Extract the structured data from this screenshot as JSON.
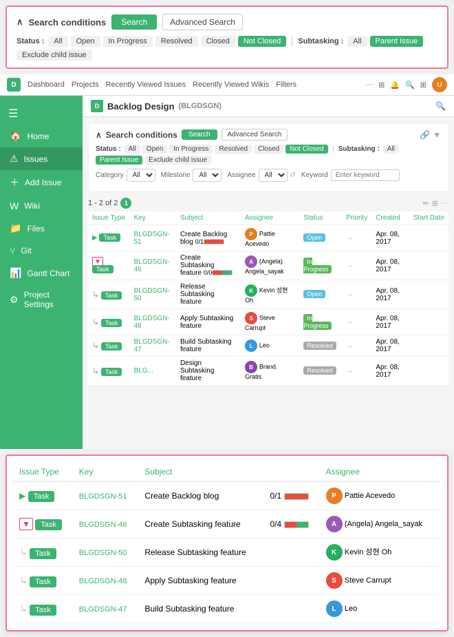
{
  "topSearch": {
    "title": "Search conditions",
    "searchBtn": "Search",
    "advancedBtn": "Advanced Search",
    "statusLabel": "Status :",
    "statuses": [
      "All",
      "Open",
      "In Progress",
      "Resolved",
      "Closed",
      "Not Closed"
    ],
    "activeStatus": "Not Closed",
    "subtaskingLabel": "Subtasking :",
    "subtaskings": [
      "All",
      "Parent Issue",
      "Exclude child issue"
    ],
    "activeSubtasking": "Parent Issue"
  },
  "nav": {
    "logo": "D",
    "links": [
      "Dashboard",
      "Projects",
      "Recently Viewed Issues",
      "Recently Viewed Wikis",
      "Filters"
    ]
  },
  "sidebar": {
    "hamburger": "☰",
    "items": [
      {
        "icon": "🏠",
        "label": "Home"
      },
      {
        "icon": "⚠",
        "label": "Issues"
      },
      {
        "icon": "+",
        "label": "Add Issue"
      },
      {
        "icon": "W",
        "label": "Wiki"
      },
      {
        "icon": "📁",
        "label": "Files"
      },
      {
        "icon": "⑂",
        "label": "Git"
      },
      {
        "icon": "📊",
        "label": "Gantt Chart"
      },
      {
        "icon": "⚙",
        "label": "Project Settings"
      }
    ]
  },
  "content": {
    "projectName": "Backlog Design",
    "projectId": "(BLGDSGN)",
    "searchTitle": "Search conditions",
    "searchBtn": "Search",
    "advancedBtn": "Advanced Search",
    "statusLabel": "Status :",
    "statuses": [
      "All",
      "Open",
      "In Progress",
      "Resolved",
      "Closed",
      "Not Closed"
    ],
    "activeStatus": "Not Closed",
    "subtaskingLabel": "Subtasking :",
    "subtaskings": [
      "All",
      "Parent Issue",
      "Exclude child issue"
    ],
    "activeSubtasking": "Parent Issue",
    "categoryLabel": "Category",
    "milestoneLabel": "Milestone",
    "assigneeLabel": "Assignee",
    "keywordLabel": "Keyword",
    "keywordPlaceholder": "Enter keyword",
    "resultText": "1 - 2 of 2",
    "resultCount": "1",
    "tableHeaders": [
      "Issue Type",
      "Key",
      "Subject",
      "Assignee",
      "Status",
      "Priority",
      "Created",
      "Start Date"
    ],
    "rows": [
      {
        "expand": "▶",
        "type": "Task",
        "key": "BLGDSGN-51",
        "subject": "Create Backlog blog",
        "progress": "0/1",
        "progressType": "red",
        "assigneeColor": "#e67e22",
        "assigneeInitial": "P",
        "assignee": "Pattie Acevedo",
        "status": "Open",
        "statusType": "open",
        "date": "Apr. 08, 2017"
      },
      {
        "expand": "▼",
        "type": "Task",
        "key": "BLGDSGN-46",
        "subject": "Create Subtasking feature",
        "progress": "0/0",
        "progressType": "multi",
        "assigneeColor": "#9b59b6",
        "assigneeInitial": "A",
        "assignee": "(Angela) Angela_sayak",
        "status": "In Progress",
        "statusType": "inprogress",
        "date": "Apr. 08, 2017"
      },
      {
        "expand": "↳",
        "type": "Task",
        "key": "BLGDSGN-50",
        "subject": "Release Subtasking feature",
        "progress": "",
        "progressType": "",
        "assigneeColor": "#27ae60",
        "assigneeInitial": "K",
        "assignee": "Kevin 성현 Oh",
        "status": "Open",
        "statusType": "open",
        "date": "Apr. 08, 2017"
      },
      {
        "expand": "↳",
        "type": "Task",
        "key": "BLGDSGN-48",
        "subject": "Apply Subtasking feature",
        "progress": "",
        "progressType": "",
        "assigneeColor": "#e74c3c",
        "assigneeInitial": "S",
        "assignee": "Steve Carrupt",
        "status": "In Progress",
        "statusType": "inprogress",
        "date": "Apr. 08, 2017"
      },
      {
        "expand": "↳",
        "type": "Task",
        "key": "BLGDSGN-47",
        "subject": "Build Subtasking feature",
        "progress": "",
        "progressType": "",
        "assigneeColor": "#3498db",
        "assigneeInitial": "L",
        "assignee": "Leo",
        "status": "Resolved",
        "statusType": "resolved",
        "date": "Apr. 08, 2017"
      },
      {
        "expand": "↳",
        "type": "Task",
        "key": "BLG...",
        "subject": "Design Subtasking feature",
        "progress": "",
        "progressType": "",
        "assigneeColor": "#8e44ad",
        "assigneeInitial": "B",
        "assignee": "Brand. Gratis",
        "status": "Resolved",
        "statusType": "resolved",
        "date": "Apr. 08, 2017"
      }
    ]
  },
  "zoomPanel": {
    "headers": [
      "Issue Type",
      "Key",
      "Subject",
      "",
      "Assignee"
    ],
    "rows": [
      {
        "expand": "▶",
        "expandType": "normal",
        "type": "Task",
        "key": "BLGDSGN-51",
        "subject": "Create Backlog blog",
        "progress": "0/1",
        "progressType": "red",
        "assigneeColor": "#e67e22",
        "assigneeInitial": "P",
        "assignee": "Pattie Acevedo"
      },
      {
        "expand": "▼",
        "expandType": "down",
        "type": "Task",
        "key": "BLGDSGN-46",
        "subject": "Create Subtasking feature",
        "progress": "0/4",
        "progressType": "multi",
        "assigneeColor": "#9b59b6",
        "assigneeInitial": "A",
        "assignee": "(Angela) Angela_sayak"
      },
      {
        "expand": "↳",
        "expandType": "sub",
        "type": "Task",
        "key": "BLGDSGN-50",
        "subject": "Release Subtasking feature",
        "progress": "",
        "progressType": "",
        "assigneeColor": "#27ae60",
        "assigneeInitial": "K",
        "assignee": "Kevin 성현 Oh"
      },
      {
        "expand": "↳",
        "expandType": "sub",
        "type": "Task",
        "key": "BLGDSGN-48",
        "subject": "Apply Subtasking feature",
        "progress": "",
        "progressType": "",
        "assigneeColor": "#e74c3c",
        "assigneeInitial": "S",
        "assignee": "Steve Carrupt"
      },
      {
        "expand": "↳",
        "expandType": "sub",
        "type": "Task",
        "key": "BLGDSGN-47",
        "subject": "Build Subtasking feature",
        "progress": "",
        "progressType": "",
        "assigneeColor": "#3498db",
        "assigneeInitial": "L",
        "assignee": "Leo"
      }
    ]
  }
}
